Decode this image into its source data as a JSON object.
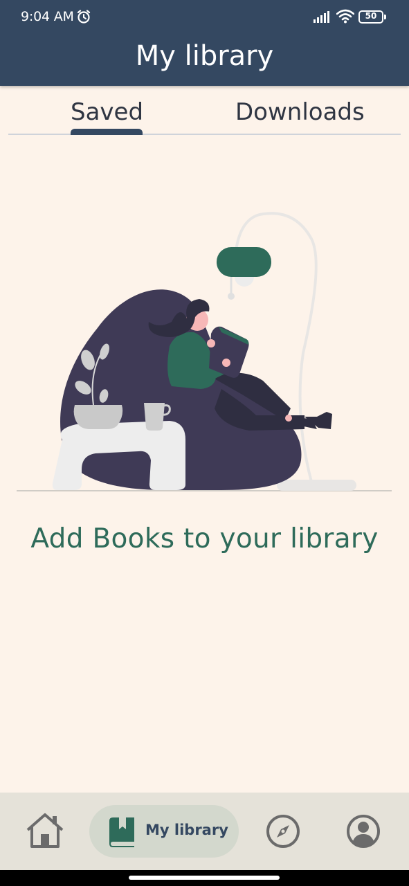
{
  "status_bar": {
    "time": "9:04 AM",
    "battery_level": "50",
    "icons": [
      "alarm-icon",
      "signal-icon",
      "wifi-icon",
      "battery-icon"
    ]
  },
  "header": {
    "title": "My library"
  },
  "tabs": [
    {
      "label": "Saved",
      "selected": true
    },
    {
      "label": "Downloads",
      "selected": false
    }
  ],
  "empty_state": {
    "illustration": "reading-woman-illustration",
    "message": "Add Books to your library"
  },
  "bottom_nav": {
    "items": [
      {
        "icon": "home-icon",
        "label": "",
        "active": false
      },
      {
        "icon": "book-icon",
        "label": "My library",
        "active": true
      },
      {
        "icon": "compass-icon",
        "label": "",
        "active": false
      },
      {
        "icon": "account-icon",
        "label": "",
        "active": false
      }
    ]
  },
  "colors": {
    "header": "#344861",
    "background": "#fdf3ea",
    "accent": "#2e6b5a",
    "nav_background": "#e5e2d9",
    "nav_active_pill": "#d3d8cd"
  }
}
